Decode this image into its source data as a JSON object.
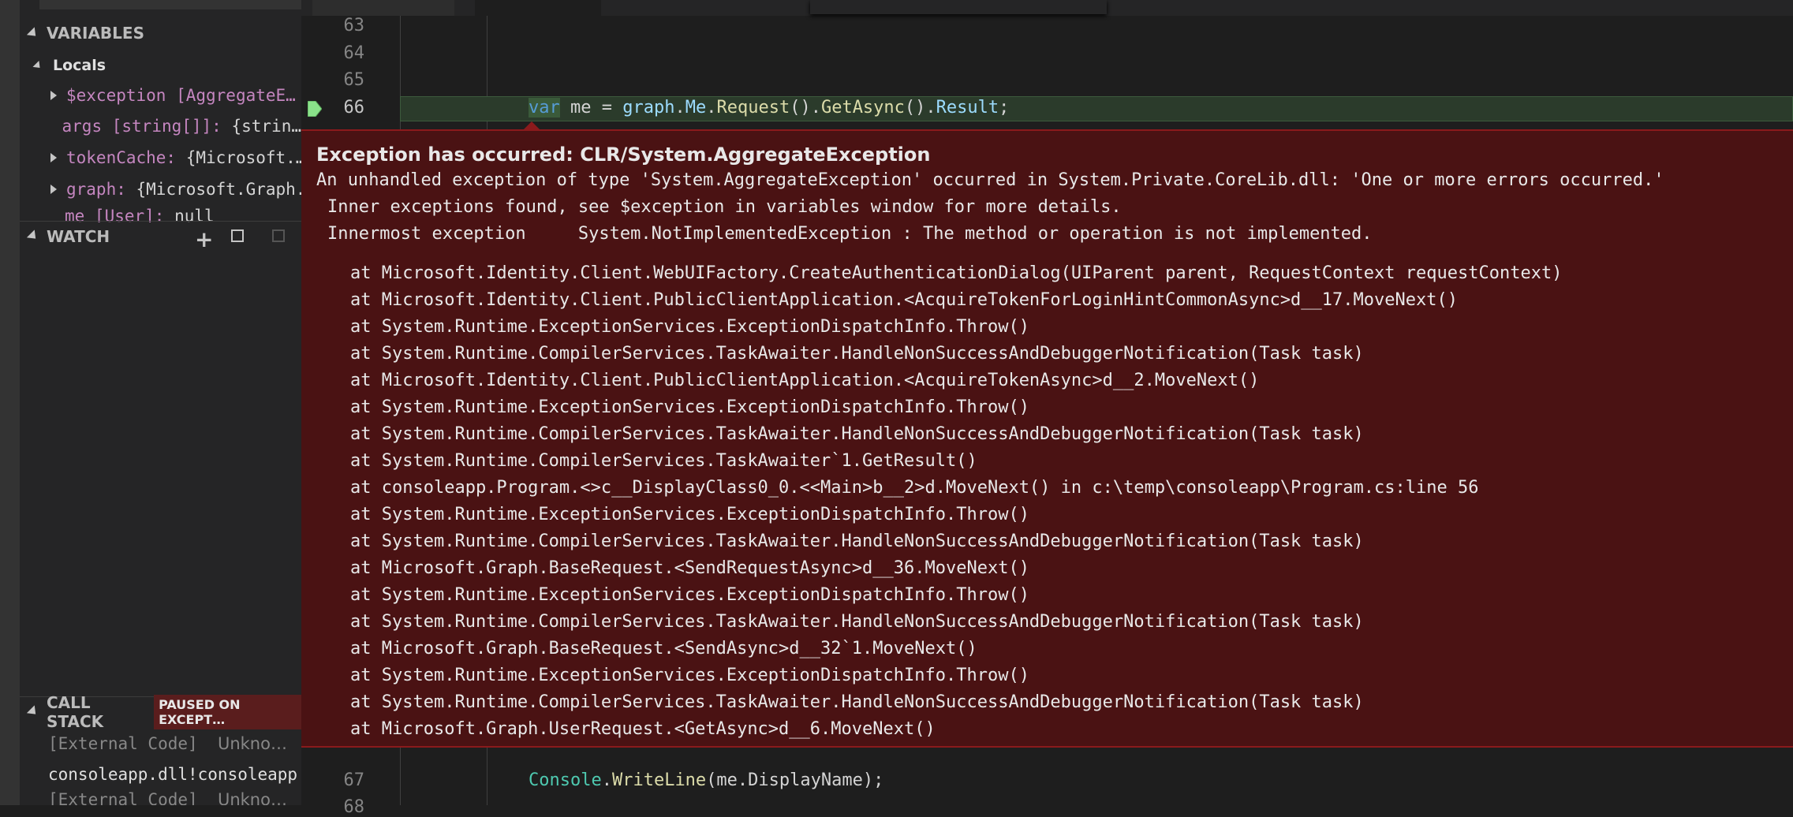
{
  "sidebar": {
    "variables_header": "VARIABLES",
    "locals_label": "Locals",
    "variables": [
      {
        "name": "$exception",
        "value": "[AggregateE…",
        "expandable": true
      },
      {
        "name": "args",
        "type": "[string[]]:",
        "value": "{strin…",
        "expandable": false
      },
      {
        "name": "tokenCache:",
        "value": "{Microsoft.…",
        "expandable": true
      },
      {
        "name": "graph:",
        "value": "{Microsoft.Graph.…",
        "expandable": true
      },
      {
        "name": "me [User]:",
        "value": "null",
        "expandable": false
      }
    ],
    "watch_header": "WATCH",
    "callstack_header": "CALL STACK",
    "callstack_badge": "PAUSED ON EXCEPT…",
    "callstack": [
      {
        "label": "[External Code]",
        "detail": "Unkno…"
      },
      {
        "label": "consoleapp.dll!consoleapp",
        "detail": ""
      },
      {
        "label": "[External Code]",
        "detail": "Unkno…"
      }
    ]
  },
  "editor": {
    "line_numbers": [
      "63",
      "64",
      "65",
      "66",
      "67",
      "68"
    ],
    "current_line": {
      "kw": "var",
      "ident": "me",
      "eq": " = ",
      "obj": "graph",
      "dot1": ".",
      "prop": "Me",
      "dot2": ".",
      "m1": "Request",
      "p1": "().",
      "m2": "GetAsync",
      "p2": "().",
      "m3": "Result",
      "end": ";"
    },
    "line67": {
      "cls": "Console",
      "dot": ".",
      "method": "WriteLine",
      "args": "(me.DisplayName);"
    }
  },
  "exception": {
    "title": "Exception has occurred: CLR/System.AggregateException",
    "message": "An unhandled exception of type 'System.AggregateException' occurred in System.Private.CoreLib.dll: 'One or more errors occurred.'",
    "inner_note": "Inner exceptions found, see $exception in variables window for more details.",
    "innermost_label": "Innermost exception",
    "innermost_value": "System.NotImplementedException : The method or operation is not implemented.",
    "stack": [
      "at Microsoft.Identity.Client.WebUIFactory.CreateAuthenticationDialog(UIParent parent, RequestContext requestContext)",
      "at Microsoft.Identity.Client.PublicClientApplication.<AcquireTokenForLoginHintCommonAsync>d__17.MoveNext()",
      "at System.Runtime.ExceptionServices.ExceptionDispatchInfo.Throw()",
      "at System.Runtime.CompilerServices.TaskAwaiter.HandleNonSuccessAndDebuggerNotification(Task task)",
      "at Microsoft.Identity.Client.PublicClientApplication.<AcquireTokenAsync>d__2.MoveNext()",
      "at System.Runtime.ExceptionServices.ExceptionDispatchInfo.Throw()",
      "at System.Runtime.CompilerServices.TaskAwaiter.HandleNonSuccessAndDebuggerNotification(Task task)",
      "at System.Runtime.CompilerServices.TaskAwaiter`1.GetResult()",
      "at consoleapp.Program.<>c__DisplayClass0_0.<<Main>b__2>d.MoveNext() in c:\\temp\\consoleapp\\Program.cs:line 56",
      "at System.Runtime.ExceptionServices.ExceptionDispatchInfo.Throw()",
      "at System.Runtime.CompilerServices.TaskAwaiter.HandleNonSuccessAndDebuggerNotification(Task task)",
      "at Microsoft.Graph.BaseRequest.<SendRequestAsync>d__36.MoveNext()",
      "at System.Runtime.ExceptionServices.ExceptionDispatchInfo.Throw()",
      "at System.Runtime.CompilerServices.TaskAwaiter.HandleNonSuccessAndDebuggerNotification(Task task)",
      "at Microsoft.Graph.BaseRequest.<SendAsync>d__32`1.MoveNext()",
      "at System.Runtime.ExceptionServices.ExceptionDispatchInfo.Throw()",
      "at System.Runtime.CompilerServices.TaskAwaiter.HandleNonSuccessAndDebuggerNotification(Task task)",
      "at Microsoft.Graph.UserRequest.<GetAsync>d__6.MoveNext()"
    ]
  },
  "colors": {
    "exception_bg": "#4a1213",
    "exception_border": "#8b1a1c",
    "current_line_bg": "#2b3b2b",
    "badge_bg": "#5a1d1d"
  }
}
